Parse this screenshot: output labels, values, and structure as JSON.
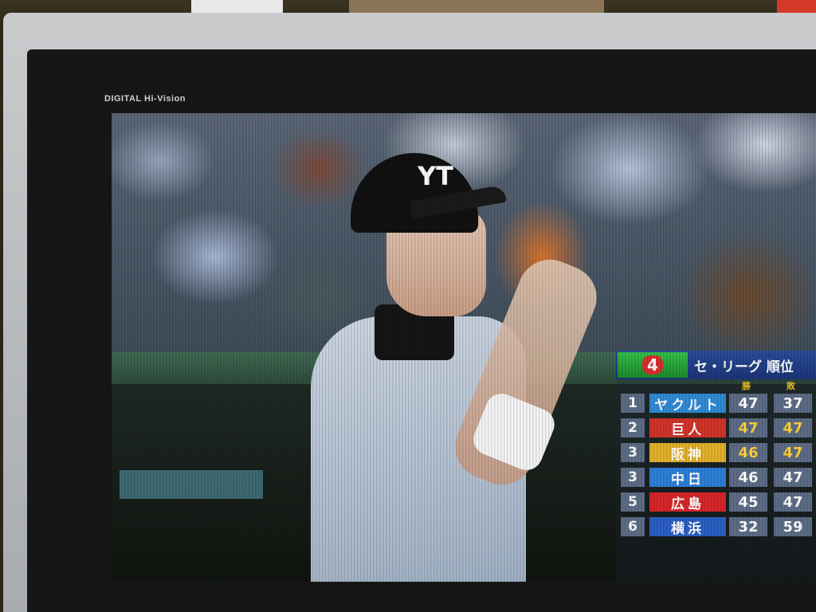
{
  "tv": {
    "brand_label": "DIGITAL Hi-Vision"
  },
  "broadcast": {
    "cap_logo": "YT",
    "standings": {
      "league_badge": "4",
      "title": "セ・リーグ 順位",
      "col_wins": "勝",
      "col_losses": "敗",
      "rows": [
        {
          "rank": "1",
          "team": "ヤクルト",
          "wins": "47",
          "losses": "37",
          "team_color": "#2f8bd6",
          "highlight": false
        },
        {
          "rank": "2",
          "team": "巨人",
          "wins": "47",
          "losses": "47",
          "team_color": "#d2342a",
          "highlight": true
        },
        {
          "rank": "3",
          "team": "阪神",
          "wins": "46",
          "losses": "47",
          "team_color": "#e3b12a",
          "highlight": true
        },
        {
          "rank": "3",
          "team": "中日",
          "wins": "46",
          "losses": "47",
          "team_color": "#2c7fd8",
          "highlight": false
        },
        {
          "rank": "5",
          "team": "広島",
          "wins": "45",
          "losses": "47",
          "team_color": "#d8262a",
          "highlight": false
        },
        {
          "rank": "6",
          "team": "横浜",
          "wins": "32",
          "losses": "59",
          "team_color": "#2b5fc4",
          "highlight": false
        }
      ]
    }
  }
}
